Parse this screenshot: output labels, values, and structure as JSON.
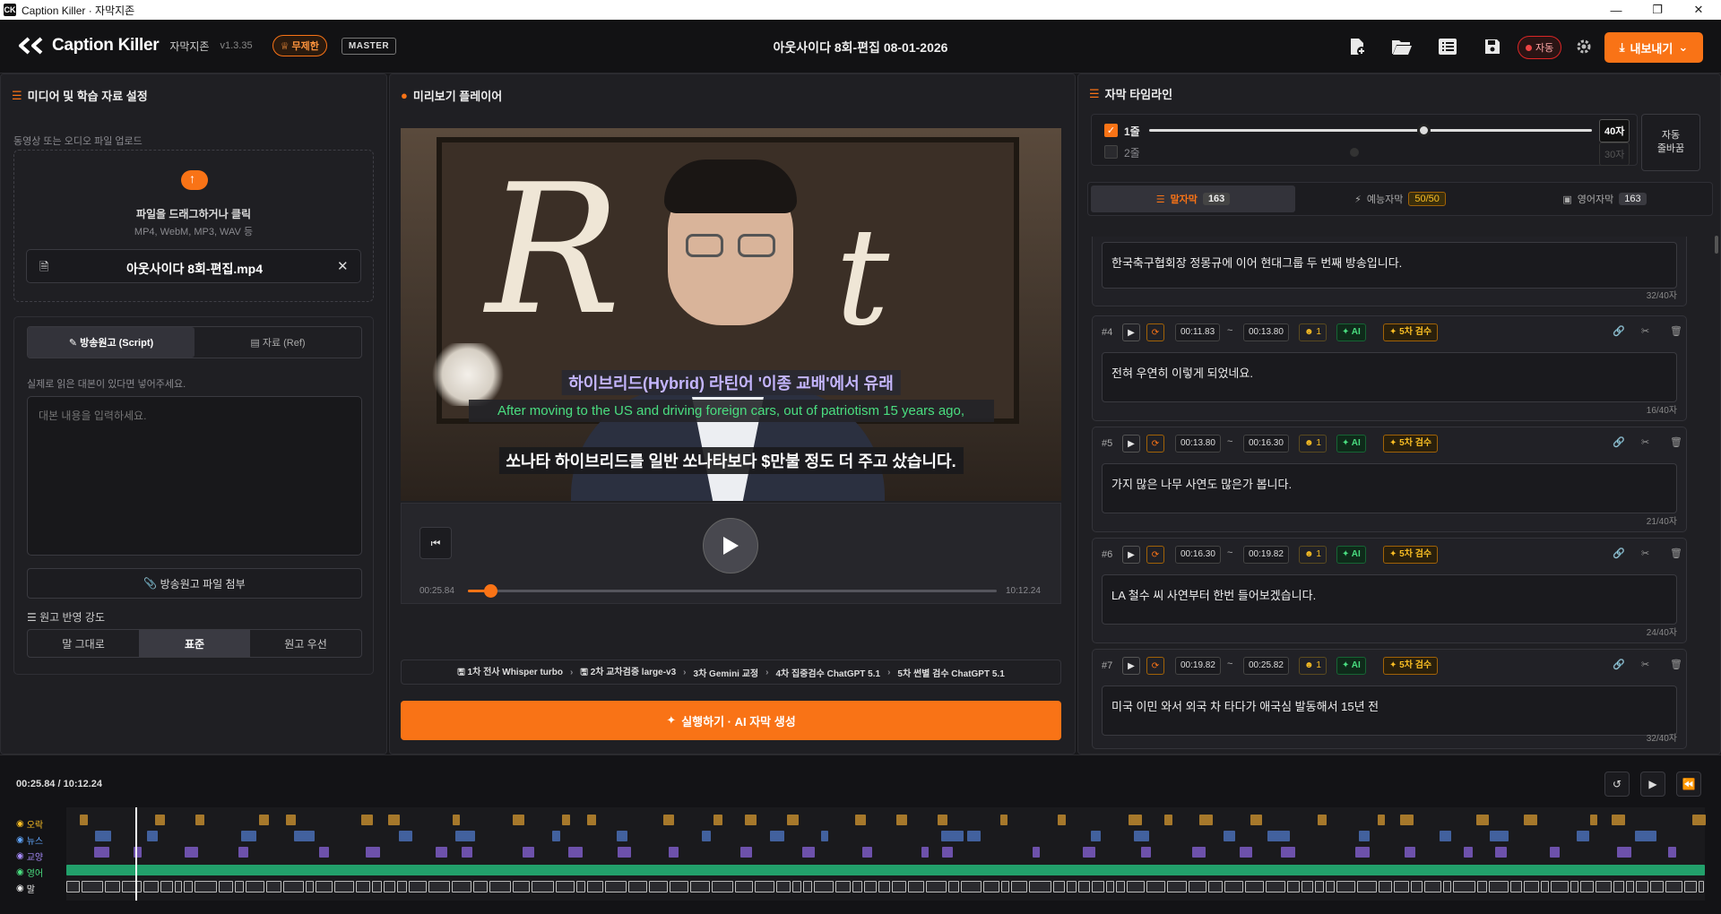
{
  "window": {
    "title": "Caption Killer · 자막지존"
  },
  "app": {
    "name": "Caption Killer",
    "subname": "자막지존",
    "version": "v1.3.35",
    "plan_badge": "무제한",
    "role_badge": "MASTER"
  },
  "document": {
    "title": "아웃사이다 8회-편집 08-01-2026"
  },
  "toolbar": {
    "auto_label": "자동",
    "export_label": "내보내기"
  },
  "left": {
    "title": "미디어 및 학습 자료 설정",
    "upload_label": "동영상 또는 오디오 파일 업로드",
    "drop_text": "파일을 드래그하거나 클릭",
    "drop_formats": "MP4, WebM, MP3, WAV 등",
    "file_name": "아웃사이다 8회-편집.mp4",
    "tabs": [
      {
        "label": "방송원고 (Script)"
      },
      {
        "label": "자료 (Ref)"
      }
    ],
    "script_hint": "실제로 읽은 대본이 있다면 넣어주세요.",
    "script_placeholder": "대본 내용을 입력하세요.",
    "attach_label": "방송원고 파일 첨부",
    "strength_label": "원고 반영 강도",
    "strength_options": [
      {
        "label": "말 그대로"
      },
      {
        "label": "표준"
      },
      {
        "label": "원고 우선"
      }
    ],
    "strength_selected": "표준"
  },
  "player": {
    "title": "미리보기 플레이어",
    "subtitles": {
      "line1": "하이브리드(Hybrid) 라틴어 '이종 교배'에서 유래",
      "line2": "After moving to the US and driving foreign cars, out of patriotism 15 years ago,",
      "line3": "쏘나타 하이브리드를 일반 쏘나타보다 $만불 정도 더 주고 샀습니다."
    },
    "current_time": "00:25.84",
    "total_time": "10:12.24",
    "progress": 0.042,
    "pipeline": [
      {
        "label": "1차 전사 Whisper turbo"
      },
      {
        "label": "2차 교차검증 large-v3"
      },
      {
        "label": "3차 Gemini 교정"
      },
      {
        "label": "4차 집중검수 ChatGPT 5.1"
      },
      {
        "label": "5차 썬별 검수 ChatGPT 5.1"
      }
    ],
    "run_label": "실행하기 · AI 자막 생성"
  },
  "subtitle_panel": {
    "title": "자막 타임라인",
    "line1_label": "1줄",
    "line1_value": "40자",
    "line1_checked": true,
    "line1_slider": 0.62,
    "line2_label": "2줄",
    "line2_value": "30자",
    "line2_checked": false,
    "auto_wrap_label": "자동\n줄바꿈",
    "tabs": [
      {
        "label": "말자막",
        "count": "163"
      },
      {
        "label": "예능자막",
        "count": "50/50"
      },
      {
        "label": "영어자막",
        "count": "163"
      }
    ],
    "partial": {
      "text": "한국축구협회장 정몽규에 이어 현대그룹 두 번째 방송입니다.",
      "count": "32/40자"
    },
    "cards": [
      {
        "num": "#4",
        "start": "00:11.83",
        "end": "00:13.80",
        "speaker": "1",
        "ai": "AI",
        "review": "5차 검수",
        "text": "전혀 우연히 이렇게 되었네요.",
        "count": "16/40자"
      },
      {
        "num": "#5",
        "start": "00:13.80",
        "end": "00:16.30",
        "speaker": "1",
        "ai": "AI",
        "review": "5차 검수",
        "text": "가지 많은 나무 사연도 많은가 봅니다.",
        "count": "21/40자"
      },
      {
        "num": "#6",
        "start": "00:16.30",
        "end": "00:19.82",
        "speaker": "1",
        "ai": "AI",
        "review": "5차 검수",
        "text": "LA 철수 씨 사연부터 한번 들어보겠습니다.",
        "count": "24/40자"
      },
      {
        "num": "#7",
        "start": "00:19.82",
        "end": "00:25.82",
        "speaker": "1",
        "ai": "AI",
        "review": "5차 검수",
        "text": "미국 이민 와서 외국 차 타다가 애국심 발동해서 15년 전",
        "count": "32/40자"
      }
    ]
  },
  "timeline": {
    "time_readout": "00:25.84 / 10:12.24",
    "tracks": [
      {
        "label": "오락",
        "color": "#c08a2e"
      },
      {
        "label": "뉴스",
        "color": "#4a6fb5"
      },
      {
        "label": "교양",
        "color": "#7c5cc4"
      },
      {
        "label": "영어",
        "color": "#22a06b"
      },
      {
        "label": "말",
        "color": "#dddddd"
      }
    ],
    "playhead": 0.042
  }
}
